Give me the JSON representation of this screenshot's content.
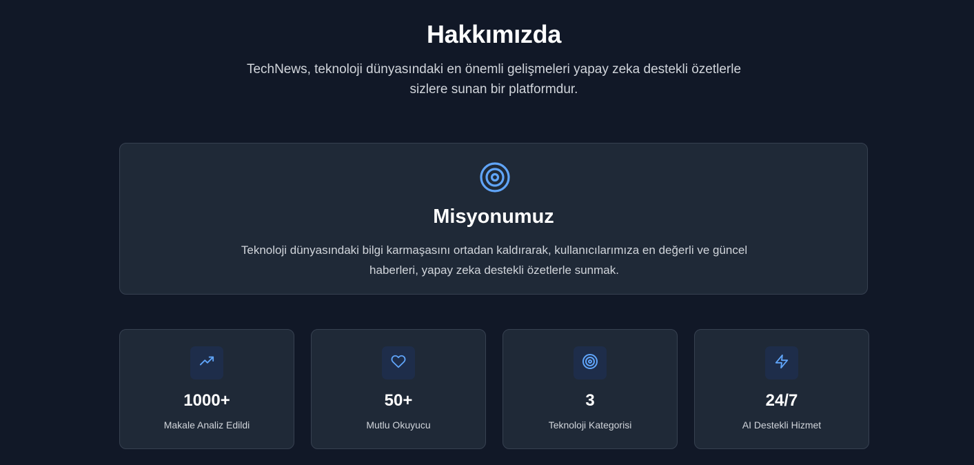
{
  "about": {
    "title": "Hakkımızda",
    "description": "TechNews, teknoloji dünyasındaki en önemli gelişmeleri yapay zeka destekli özetlerle sizlere sunan bir platformdur."
  },
  "mission": {
    "icon": "target-icon",
    "title": "Misyonumuz",
    "text": "Teknoloji dünyasındaki bilgi karmaşasını ortadan kaldırarak, kullanıcılarımıza en değerli ve güncel haberleri, yapay zeka destekli özetlerle sunmak."
  },
  "stats": [
    {
      "icon": "trending-up-icon",
      "value": "1000+",
      "label": "Makale Analiz Edildi"
    },
    {
      "icon": "heart-icon",
      "value": "50+",
      "label": "Mutlu Okuyucu"
    },
    {
      "icon": "target-icon",
      "value": "3",
      "label": "Teknoloji Kategorisi"
    },
    {
      "icon": "zap-icon",
      "value": "24/7",
      "label": "AI Destekli Hizmet"
    }
  ],
  "colors": {
    "background": "#111827",
    "card": "#1f2937",
    "card_border": "#374151",
    "accent": "#60a5fa",
    "icon_box": "#1e2d4a"
  }
}
